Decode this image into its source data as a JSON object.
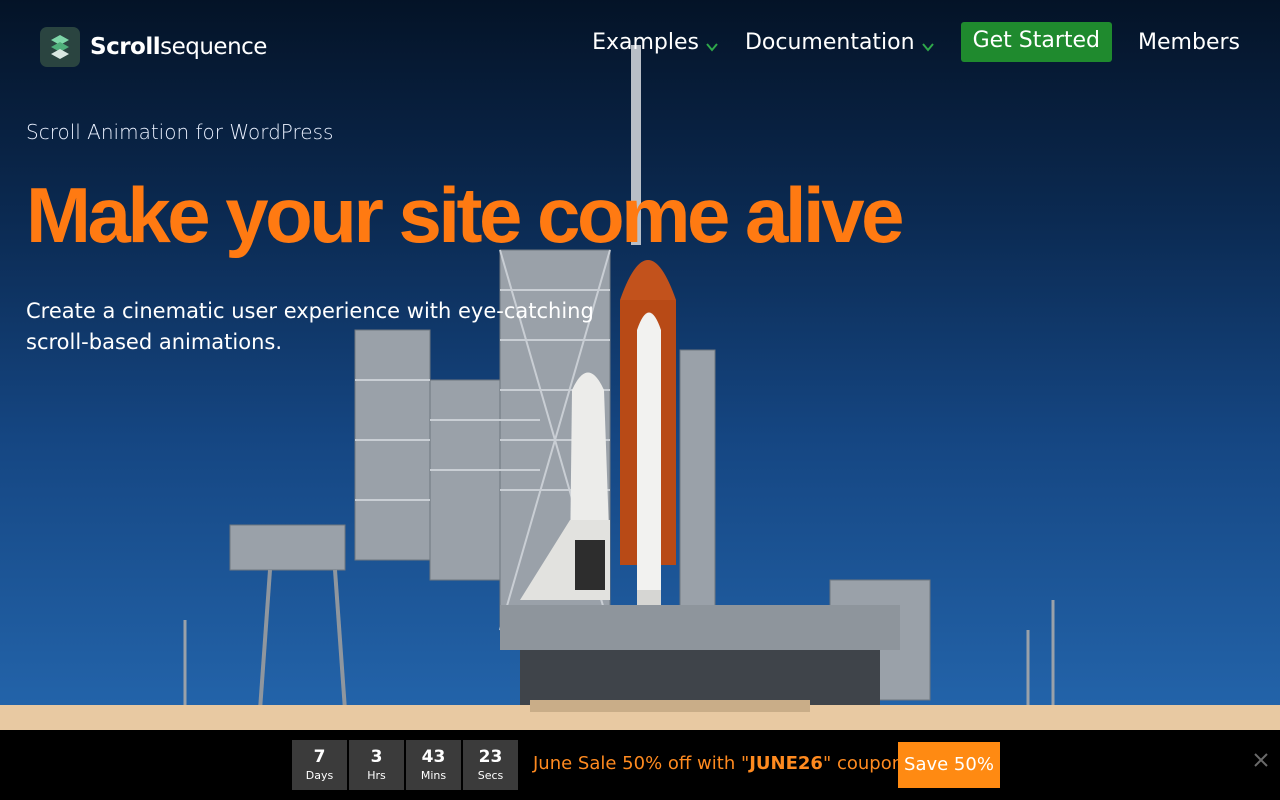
{
  "brand": {
    "name_bold": "Scroll",
    "name_light": "sequence",
    "accent": "#1f8a2e"
  },
  "nav": {
    "items": [
      {
        "label": "Examples",
        "has_dropdown": true
      },
      {
        "label": "Documentation",
        "has_dropdown": true
      }
    ],
    "cta_label": "Get Started",
    "members_label": "Members"
  },
  "hero": {
    "kicker": "Scroll Animation for WordPress",
    "headline": "Make your site come alive",
    "subline": "Create a cinematic user experience with eye-catching scroll-based animations.",
    "headline_color": "#ff7a12"
  },
  "sale": {
    "countdown": [
      {
        "value": "7",
        "unit": "Days"
      },
      {
        "value": "3",
        "unit": "Hrs"
      },
      {
        "value": "43",
        "unit": "Mins"
      },
      {
        "value": "23",
        "unit": "Secs"
      }
    ],
    "text_before": "June Sale 50% off with \"",
    "coupon": "JUNE26",
    "text_after": "\" coupon!",
    "button_label": "Save 50%",
    "color": "#ff8a12"
  },
  "icons": {
    "logo": "scrollsequence-logo-icon",
    "dropdown": "chevron-down-icon",
    "close": "close-icon"
  }
}
